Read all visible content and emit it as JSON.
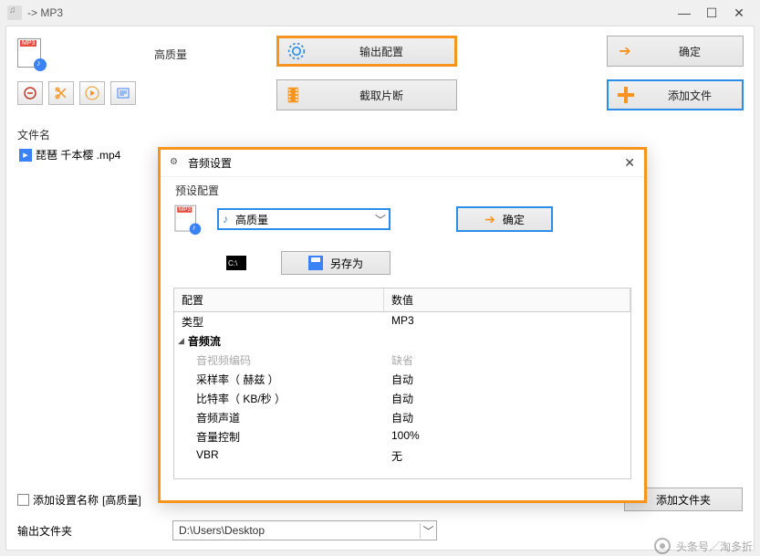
{
  "window": {
    "title": "-> MP3"
  },
  "top": {
    "quality_label": "高质量",
    "output_config_label": "输出配置",
    "ok_label": "确定",
    "cut_label": "截取片断",
    "add_file_label": "添加文件"
  },
  "filelist": {
    "header": "文件名",
    "items": [
      {
        "name": "琵琶 千本樱 .mp4"
      }
    ]
  },
  "bottom": {
    "add_setting_name_label": "添加设置名称",
    "add_setting_name_value": "[高质量]",
    "add_folder_label": "添加文件夹",
    "output_folder_label": "输出文件夹",
    "output_folder_value": "D:\\Users\\Desktop"
  },
  "modal": {
    "title": "音频设置",
    "preset_label": "预设配置",
    "preset_value": "高质量",
    "ok_label": "确定",
    "saveas_label": "另存为",
    "table": {
      "col_config": "配置",
      "col_value": "数值",
      "rows": [
        {
          "k": "类型",
          "v": "MP3"
        }
      ],
      "group": "音频流",
      "subrows": [
        {
          "k": "音视频编码",
          "v": "缺省",
          "muted": true
        },
        {
          "k": "采样率（ 赫兹 ）",
          "v": "自动"
        },
        {
          "k": "比特率（ KB/秒 ）",
          "v": "自动"
        },
        {
          "k": "音频声道",
          "v": "自动"
        },
        {
          "k": "音量控制",
          "v": "100%"
        },
        {
          "k": "VBR",
          "v": "无"
        }
      ]
    }
  },
  "watermark": "头条号／淘多折"
}
